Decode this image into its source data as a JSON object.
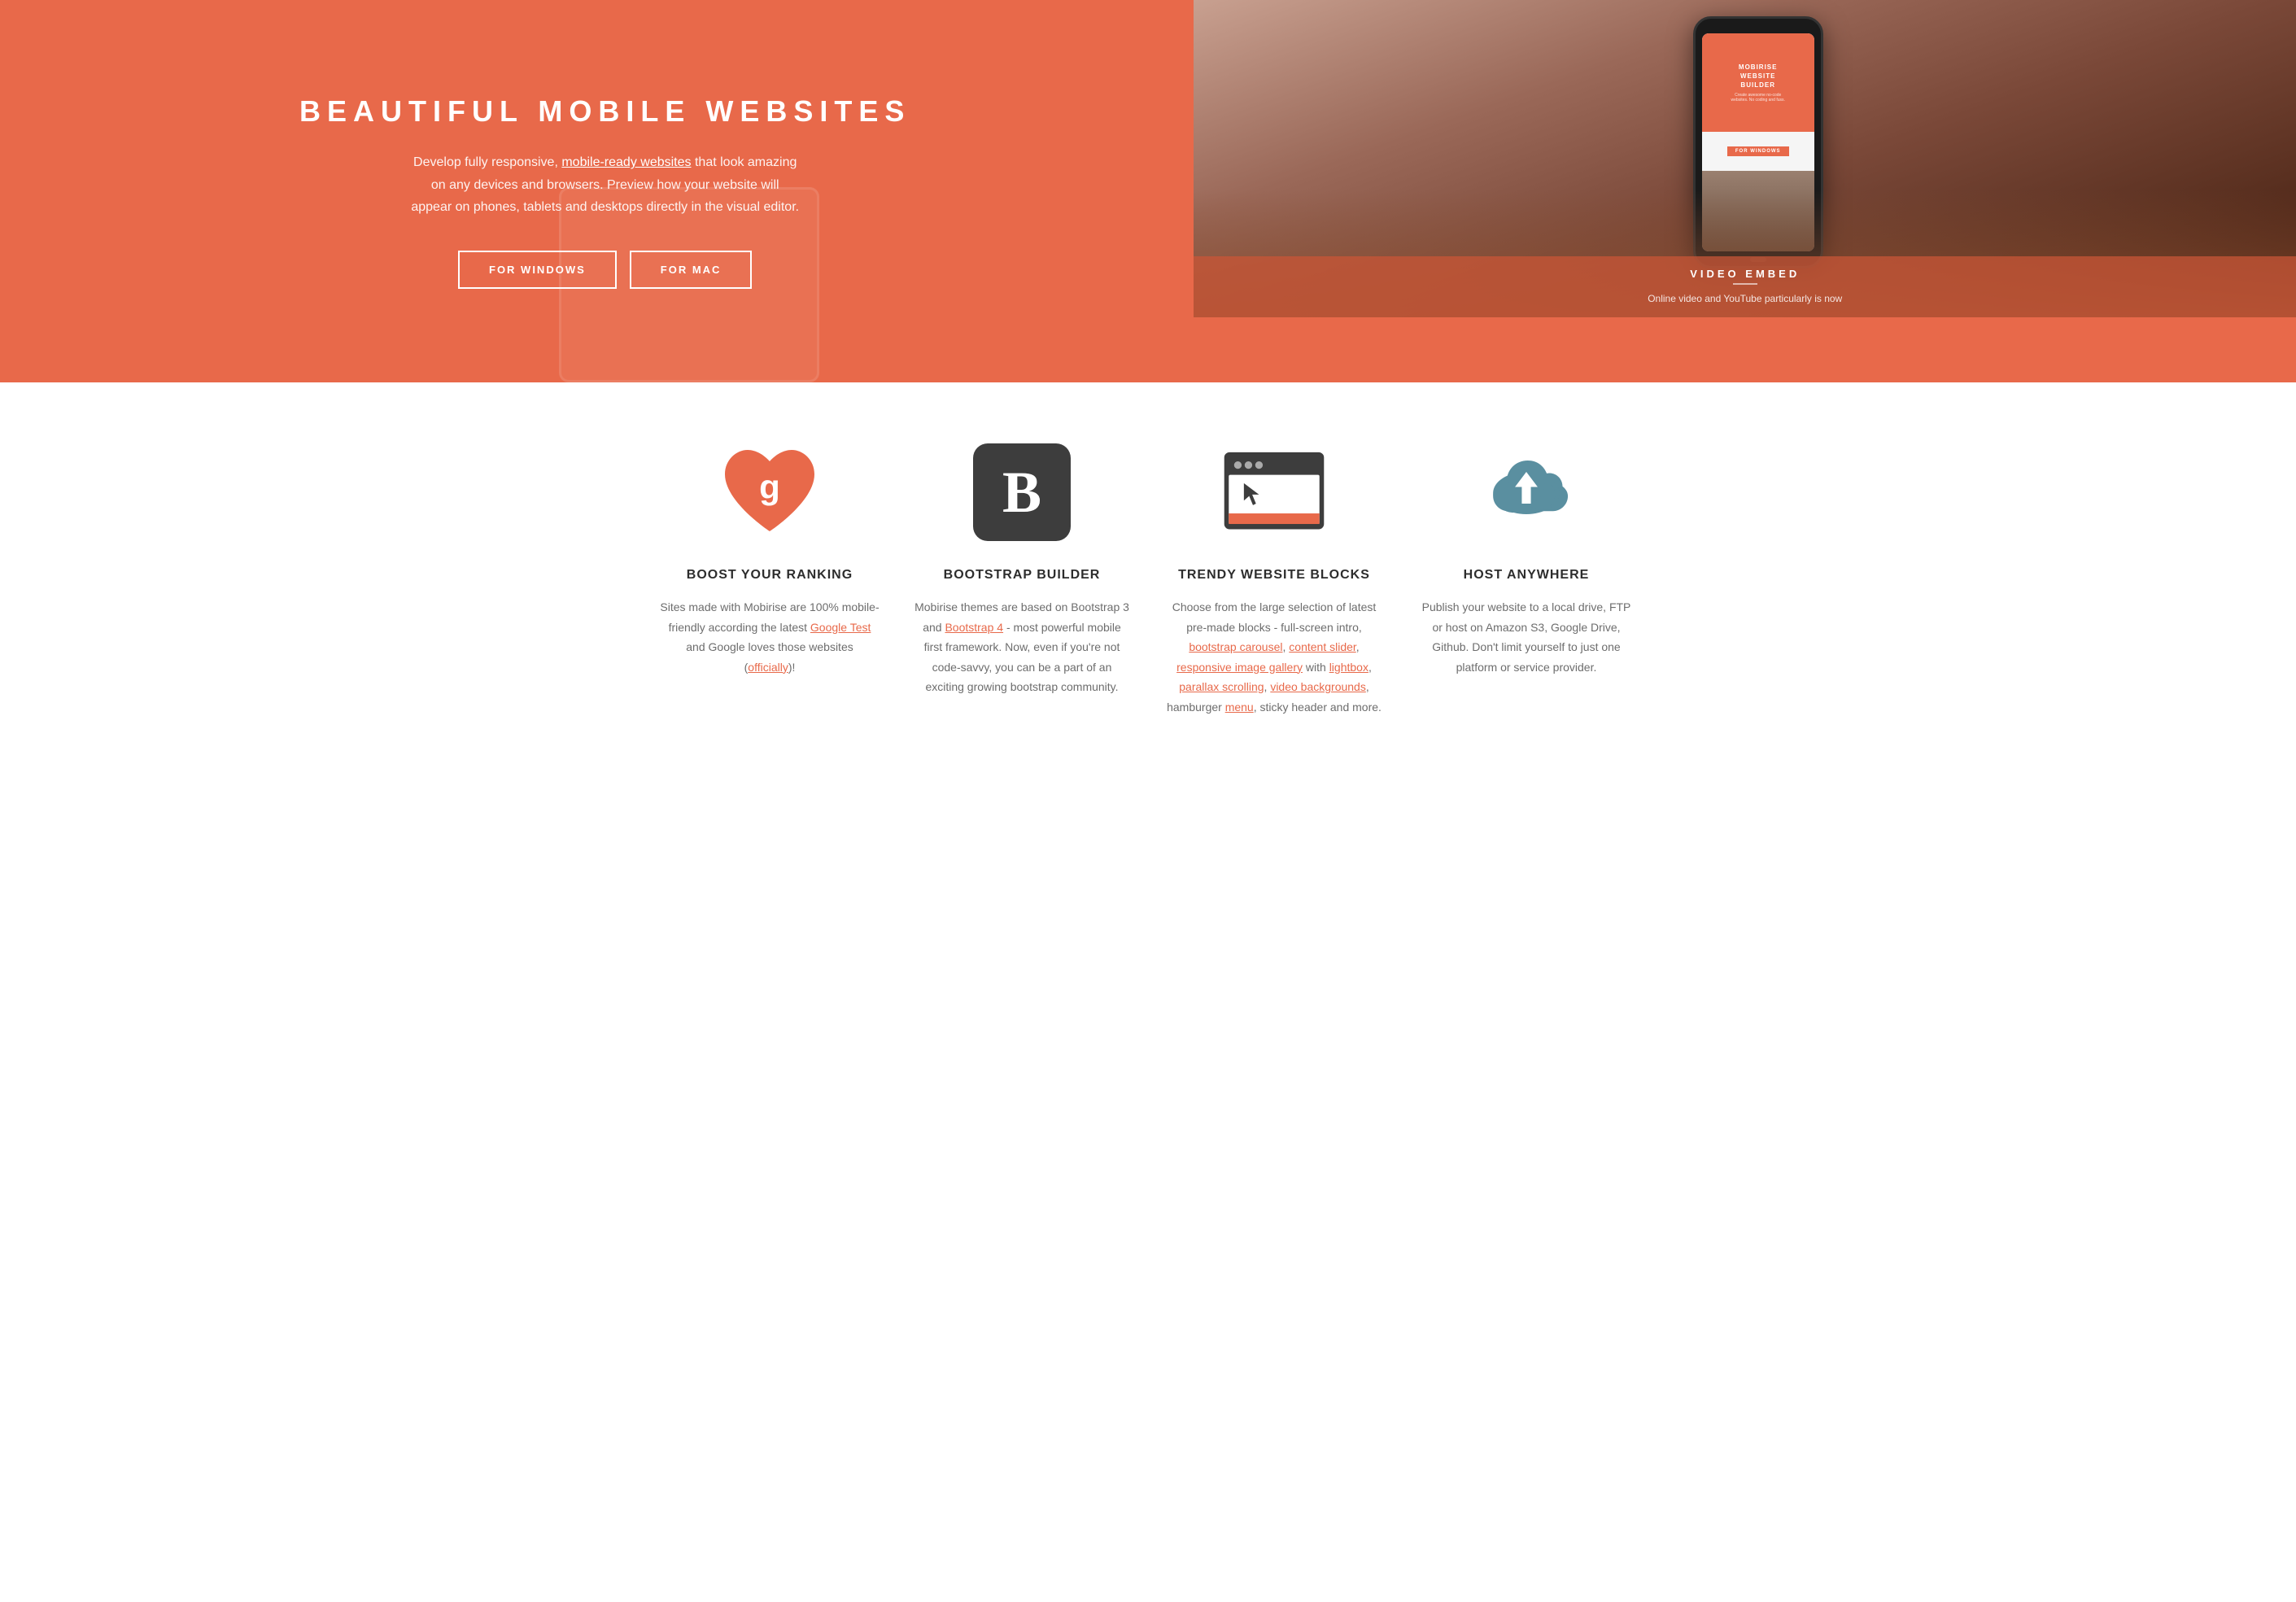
{
  "hero": {
    "title": "BEAUTIFUL MOBILE WEBSITES",
    "description_plain": "Develop fully responsive, ",
    "description_link": "mobile-ready websites",
    "description_rest": " that look amazing on any devices and browsers. Preview how your website will appear on phones, tablets and desktops directly in the visual editor.",
    "button_windows": "FOR WINDOWS",
    "button_mac": "FOR MAC",
    "video_embed_label": "VIDEO EMBED",
    "video_embed_text": "Online video and YouTube particularly is now"
  },
  "features": [
    {
      "id": "boost-ranking",
      "icon": "heart-google-icon",
      "title": "BOOST YOUR RANKING",
      "description_parts": [
        {
          "text": "Sites made with Mobirise are 100% mobile-friendly according the latest ",
          "type": "plain"
        },
        {
          "text": "Google Test",
          "type": "link"
        },
        {
          "text": " and Google loves those websites (",
          "type": "plain"
        },
        {
          "text": "officially",
          "type": "link"
        },
        {
          "text": ")!",
          "type": "plain"
        }
      ]
    },
    {
      "id": "bootstrap-builder",
      "icon": "bootstrap-icon",
      "title": "BOOTSTRAP BUILDER",
      "description_parts": [
        {
          "text": "Mobirise themes are based on Bootstrap 3 and ",
          "type": "plain"
        },
        {
          "text": "Bootstrap 4",
          "type": "link"
        },
        {
          "text": " - most powerful mobile first framework. Now, even if you're not code-savvy, you can be a part of an exciting growing bootstrap community.",
          "type": "plain"
        }
      ]
    },
    {
      "id": "trendy-blocks",
      "icon": "browser-window-icon",
      "title": "TRENDY WEBSITE BLOCKS",
      "description_parts": [
        {
          "text": "Choose from the large selection of latest pre-made blocks - full-screen intro, ",
          "type": "plain"
        },
        {
          "text": "bootstrap carousel",
          "type": "link"
        },
        {
          "text": ", ",
          "type": "plain"
        },
        {
          "text": "content slider",
          "type": "link"
        },
        {
          "text": ", ",
          "type": "plain"
        },
        {
          "text": "responsive image gallery",
          "type": "link"
        },
        {
          "text": " with ",
          "type": "plain"
        },
        {
          "text": "lightbox",
          "type": "link"
        },
        {
          "text": ", ",
          "type": "plain"
        },
        {
          "text": "parallax scrolling",
          "type": "link"
        },
        {
          "text": ", ",
          "type": "plain"
        },
        {
          "text": "video backgrounds",
          "type": "link"
        },
        {
          "text": ", hamburger ",
          "type": "plain"
        },
        {
          "text": "menu",
          "type": "link"
        },
        {
          "text": ", sticky header and more.",
          "type": "plain"
        }
      ]
    },
    {
      "id": "host-anywhere",
      "icon": "cloud-upload-icon",
      "title": "HOST ANYWHERE",
      "description_parts": [
        {
          "text": "Publish your website to a local drive, FTP or host on Amazon S3, Google Drive, Github. Don't limit yourself to just one platform or service provider.",
          "type": "plain"
        }
      ]
    }
  ],
  "colors": {
    "accent": "#e8694a",
    "dark": "#3d3d3d",
    "text_gray": "#6d6d6d",
    "hero_bg": "#d96040",
    "cloud_color": "#5a8fa0",
    "browser_bg": "#3d3d3d"
  }
}
